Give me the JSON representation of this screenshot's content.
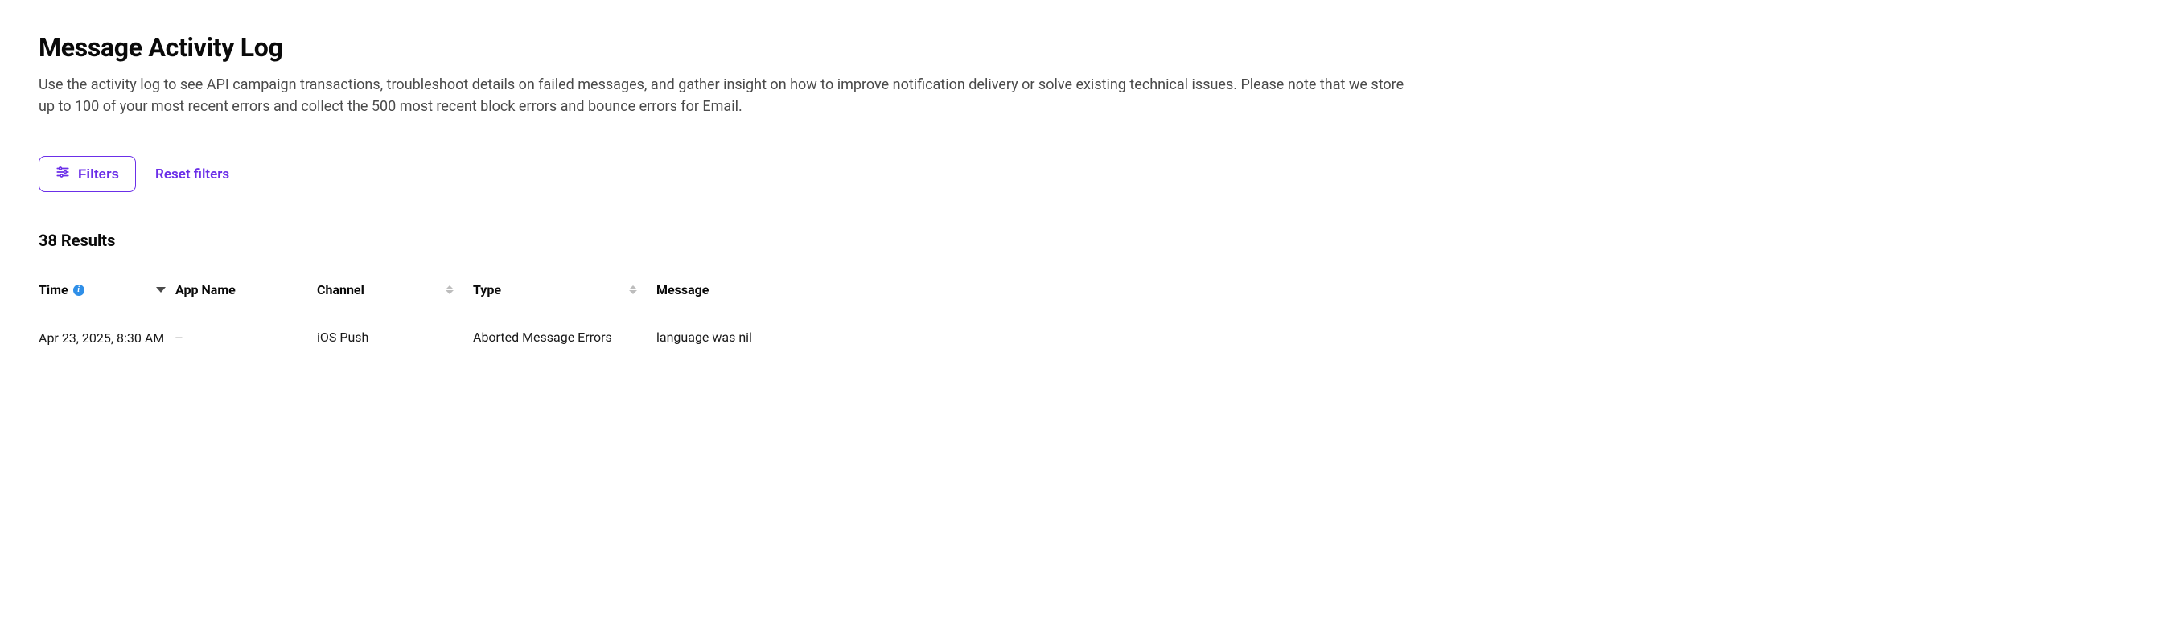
{
  "header": {
    "title": "Message Activity Log",
    "description": "Use the activity log to see API campaign transactions, troubleshoot details on failed messages, and gather insight on how to improve notification delivery or solve existing technical issues. Please note that we store up to 100 of your most recent errors and collect the 500 most recent block errors and bounce errors for Email."
  },
  "filters": {
    "button_label": "Filters",
    "reset_label": "Reset filters"
  },
  "results": {
    "count_label": "38 Results"
  },
  "table": {
    "columns": {
      "time": "Time",
      "app_name": "App Name",
      "channel": "Channel",
      "type": "Type",
      "message": "Message"
    },
    "rows": [
      {
        "time": "Apr 23, 2025, 8:30 AM",
        "app_name": "--",
        "channel": "iOS Push",
        "type": "Aborted Message Errors",
        "message": "language was nil"
      }
    ]
  }
}
